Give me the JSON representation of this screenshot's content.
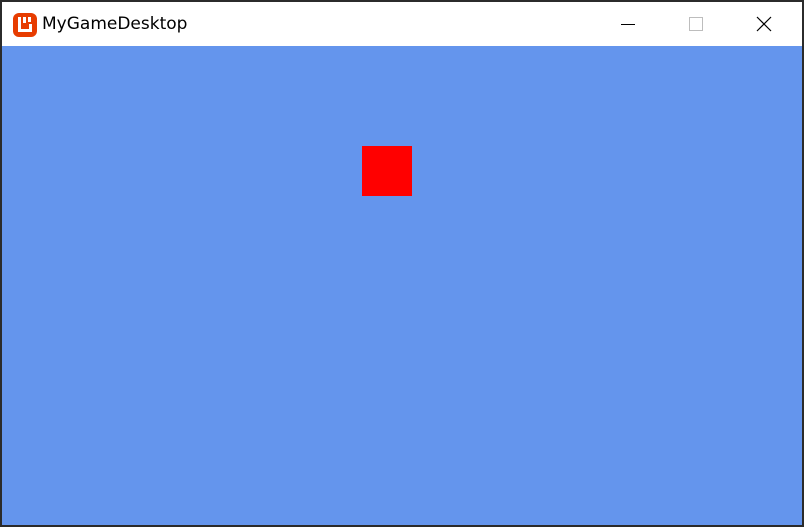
{
  "window": {
    "title": "MyGameDesktop",
    "app_icon": "monogame-logo-icon",
    "controls": {
      "minimize_icon": "minimize-icon",
      "maximize_icon": "maximize-icon",
      "close_icon": "close-icon"
    }
  },
  "game": {
    "background_color": "#6495ed",
    "sprite_color": "#ff0000"
  },
  "colors": {
    "icon_accent": "#e73c00",
    "titlebar": "#ffffff"
  }
}
